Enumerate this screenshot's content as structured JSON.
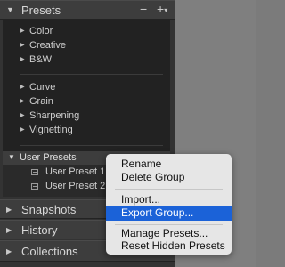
{
  "panel": {
    "presets_title": "Presets",
    "minus": "−",
    "plus": "+",
    "groups_a": [
      "Color",
      "Creative",
      "B&W"
    ],
    "groups_b": [
      "Curve",
      "Grain",
      "Sharpening",
      "Vignetting"
    ],
    "user_group": {
      "label": "User Presets",
      "items": [
        "User Preset 1",
        "User Preset 2"
      ]
    },
    "sections": [
      "Snapshots",
      "History",
      "Collections"
    ]
  },
  "context_menu": {
    "rename": "Rename",
    "delete_group": "Delete Group",
    "import": "Import...",
    "export_group": "Export Group...",
    "manage_presets": "Manage Presets...",
    "reset_hidden": "Reset Hidden Presets"
  },
  "colors": {
    "panel_bg": "#333333",
    "highlight": "#1b62d8",
    "menu_bg": "#e6e6e6"
  }
}
